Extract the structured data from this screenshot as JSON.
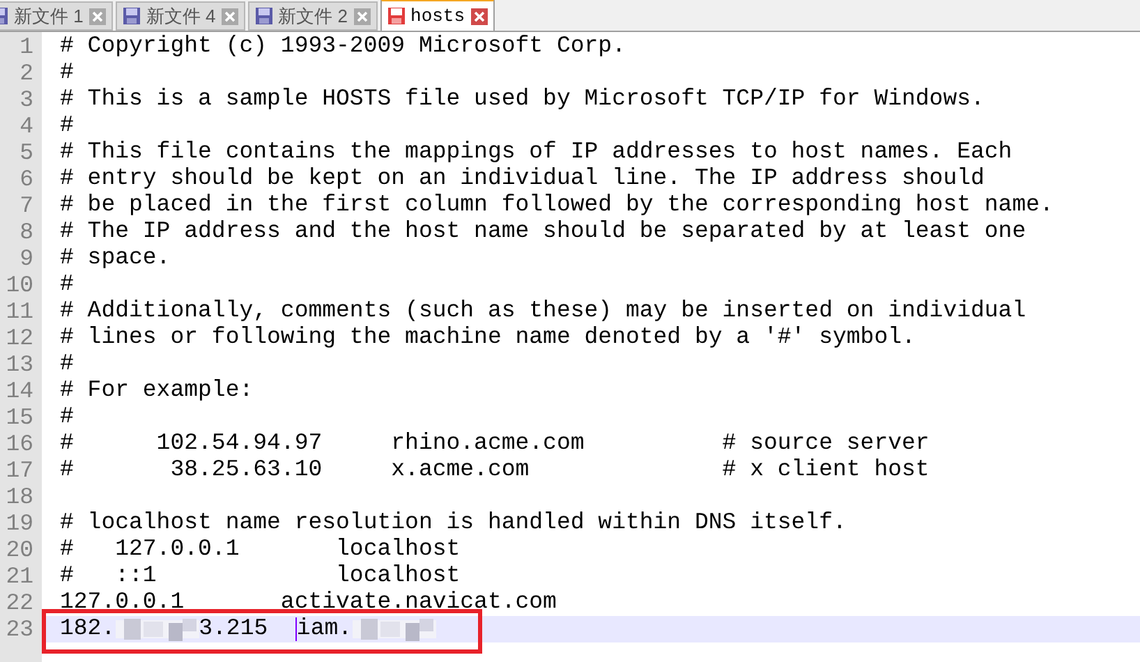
{
  "tabs": [
    {
      "label": "新文件 1",
      "selected": false,
      "saved": true
    },
    {
      "label": "新文件 4",
      "selected": false,
      "saved": true
    },
    {
      "label": "新文件 2",
      "selected": false,
      "saved": true
    },
    {
      "label": "hosts",
      "selected": true,
      "saved": false
    }
  ],
  "lines": [
    {
      "number": "1",
      "text": "# Copyright (c) 1993-2009 Microsoft Corp.",
      "current": false
    },
    {
      "number": "2",
      "text": "#",
      "current": false
    },
    {
      "number": "3",
      "text": "# This is a sample HOSTS file used by Microsoft TCP/IP for Windows.",
      "current": false
    },
    {
      "number": "4",
      "text": "#",
      "current": false
    },
    {
      "number": "5",
      "text": "# This file contains the mappings of IP addresses to host names. Each",
      "current": false
    },
    {
      "number": "6",
      "text": "# entry should be kept on an individual line. The IP address should",
      "current": false
    },
    {
      "number": "7",
      "text": "# be placed in the first column followed by the corresponding host name.",
      "current": false
    },
    {
      "number": "8",
      "text": "# The IP address and the host name should be separated by at least one",
      "current": false
    },
    {
      "number": "9",
      "text": "# space.",
      "current": false
    },
    {
      "number": "10",
      "text": "#",
      "current": false
    },
    {
      "number": "11",
      "text": "# Additionally, comments (such as these) may be inserted on individual",
      "current": false
    },
    {
      "number": "12",
      "text": "# lines or following the machine name denoted by a '#' symbol.",
      "current": false
    },
    {
      "number": "13",
      "text": "#",
      "current": false
    },
    {
      "number": "14",
      "text": "# For example:",
      "current": false
    },
    {
      "number": "15",
      "text": "#",
      "current": false
    },
    {
      "number": "16",
      "text": "#      102.54.94.97     rhino.acme.com          # source server",
      "current": false
    },
    {
      "number": "17",
      "text": "#       38.25.63.10     x.acme.com              # x client host",
      "current": false
    },
    {
      "number": "18",
      "current": false
    },
    {
      "number": "19",
      "text": "# localhost name resolution is handled within DNS itself.",
      "current": false
    },
    {
      "number": "20",
      "text": "#   127.0.0.1       localhost",
      "current": false
    },
    {
      "number": "21",
      "text": "#   ::1             localhost",
      "current": false
    },
    {
      "number": "22",
      "text": "127.0.0.1       activate.navicat.com",
      "current": false
    },
    {
      "number": "23",
      "current": true,
      "annotated": true,
      "segments": [
        {
          "kind": "text",
          "text": "182."
        },
        {
          "kind": "redacted"
        },
        {
          "kind": "text",
          "text": "3.215  "
        },
        {
          "kind": "cursor"
        },
        {
          "kind": "text",
          "text": "iam."
        },
        {
          "kind": "redacted"
        }
      ]
    }
  ]
}
